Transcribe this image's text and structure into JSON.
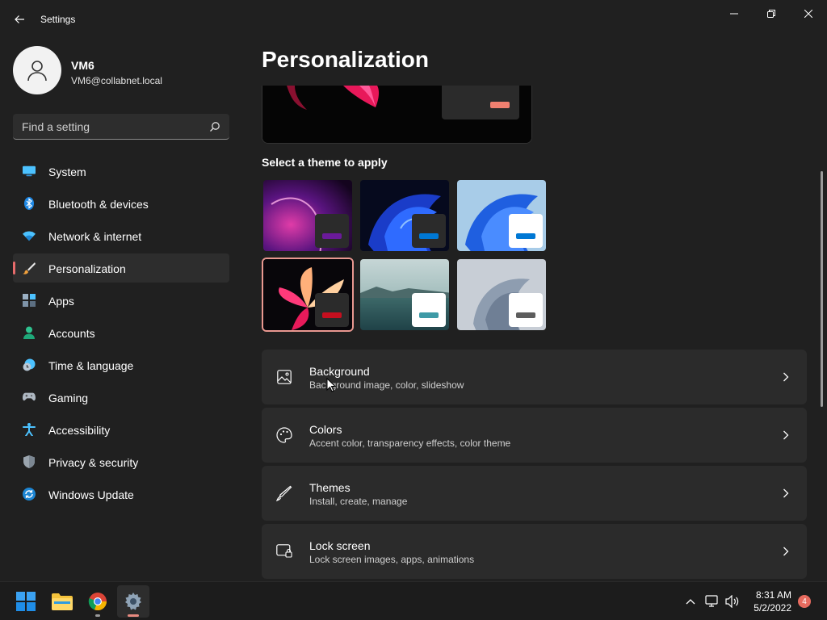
{
  "window": {
    "title": "Settings"
  },
  "profile": {
    "name": "VM6",
    "email": "VM6@collabnet.local"
  },
  "search": {
    "placeholder": "Find a setting"
  },
  "sidebar": {
    "items": [
      {
        "label": "System",
        "icon": "monitor-icon"
      },
      {
        "label": "Bluetooth & devices",
        "icon": "bluetooth-icon"
      },
      {
        "label": "Network & internet",
        "icon": "wifi-icon"
      },
      {
        "label": "Personalization",
        "icon": "brush-icon",
        "active": true
      },
      {
        "label": "Apps",
        "icon": "apps-icon"
      },
      {
        "label": "Accounts",
        "icon": "person-icon"
      },
      {
        "label": "Time & language",
        "icon": "globe-clock-icon"
      },
      {
        "label": "Gaming",
        "icon": "gamepad-icon"
      },
      {
        "label": "Accessibility",
        "icon": "accessibility-icon"
      },
      {
        "label": "Privacy & security",
        "icon": "shield-icon"
      },
      {
        "label": "Windows Update",
        "icon": "update-icon"
      }
    ]
  },
  "main": {
    "title": "Personalization",
    "themes_label": "Select a theme to apply",
    "themes": [
      {
        "id": "glow",
        "accent": "#6a1a9a",
        "window": "#2b2b2b"
      },
      {
        "id": "dark-bloom",
        "accent": "#0078d4",
        "window": "#2b2b2b"
      },
      {
        "id": "light-bloom",
        "accent": "#0078d4",
        "window": "#ffffff"
      },
      {
        "id": "captured-motion",
        "accent": "#c50f1f",
        "window": "#2b2b2b",
        "selected": true
      },
      {
        "id": "sunrise",
        "accent": "#3e9aa6",
        "window": "#ffffff"
      },
      {
        "id": "flow",
        "accent": "#5d5d5d",
        "window": "#ffffff"
      }
    ],
    "cards": [
      {
        "title": "Background",
        "subtitle": "Background image, color, slideshow",
        "icon": "image-icon"
      },
      {
        "title": "Colors",
        "subtitle": "Accent color, transparency effects, color theme",
        "icon": "palette-icon"
      },
      {
        "title": "Themes",
        "subtitle": "Install, create, manage",
        "icon": "pen-icon"
      },
      {
        "title": "Lock screen",
        "subtitle": "Lock screen images, apps, animations",
        "icon": "lock-screen-icon"
      }
    ]
  },
  "taskbar": {
    "time": "8:31 AM",
    "date": "5/2/2022",
    "notifications": "4"
  },
  "colors": {
    "accent": "#e76b6b",
    "background": "#202020",
    "card": "#2b2b2b"
  }
}
